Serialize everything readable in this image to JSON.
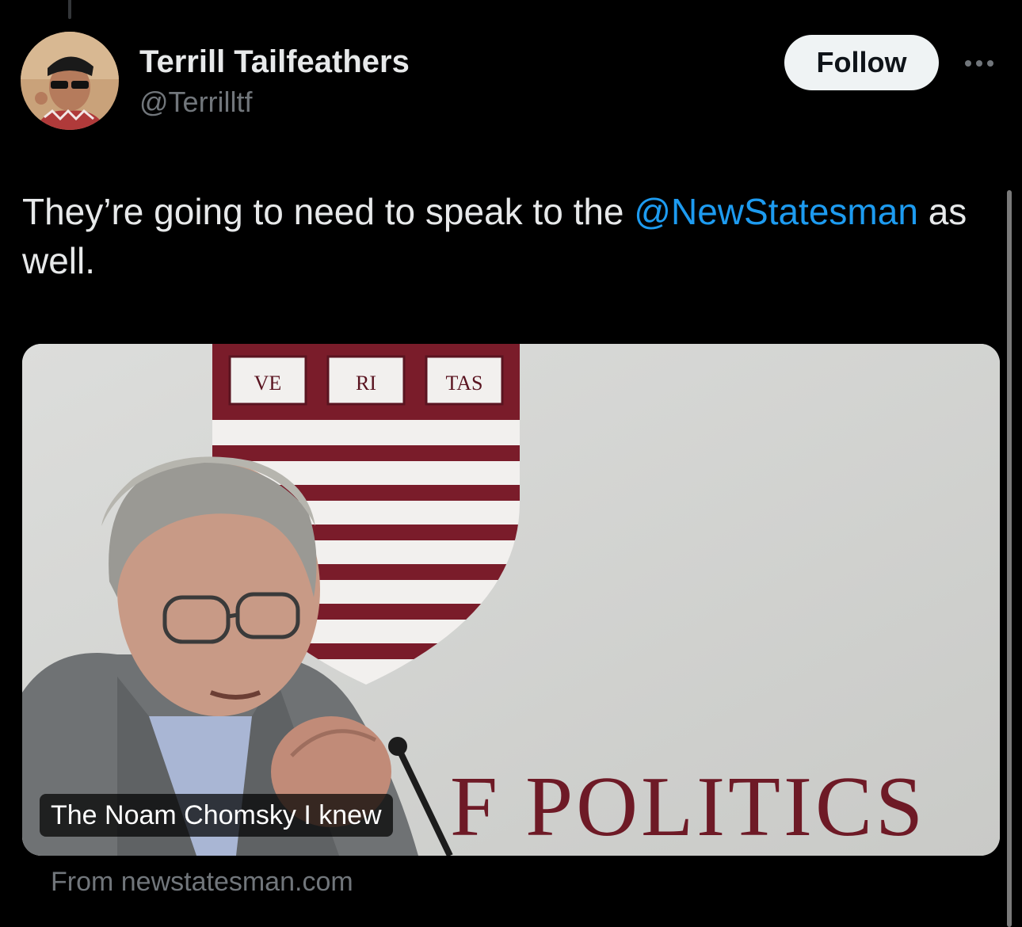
{
  "author": {
    "display_name": "Terrill Tailfeathers",
    "handle": "@Terrilltf",
    "avatar_icon": "avatar-photo"
  },
  "actions": {
    "follow_label": "Follow",
    "more_icon": "more-dots-icon"
  },
  "tweet": {
    "text_before": "They’re going to need to speak to the ",
    "mention": "@NewStatesman",
    "text_after": " as well.",
    "mention_color": "#1d9bf0"
  },
  "card": {
    "title": "The Noam Chomsky I knew",
    "source": "From newstatesman.com",
    "image": {
      "shield_letters": [
        "VE",
        "RI",
        "TAS"
      ],
      "banner_text": "F POLITICS",
      "shield_color": "#7a1c2a"
    }
  },
  "colors": {
    "background": "#000000",
    "primary_text": "#e7e9ea",
    "secondary_text": "#71767b",
    "follow_bg": "#eff3f4"
  }
}
